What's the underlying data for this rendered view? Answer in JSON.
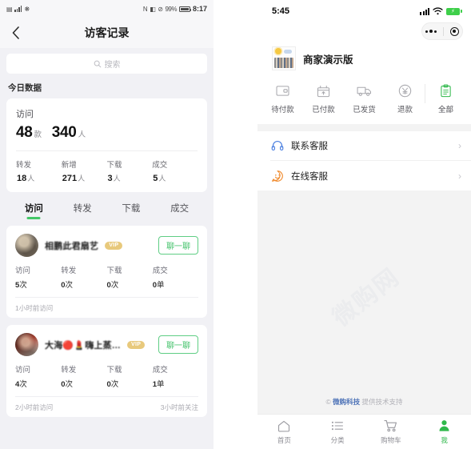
{
  "left_phone": {
    "status_bar": {
      "icons_left": [
        "sim-icon",
        "signal-icon",
        "wifi-icon"
      ],
      "icons_right": [
        "nfc-icon",
        "vibrate-icon",
        "dnd-icon"
      ],
      "battery_percent": "99%",
      "time": "8:17"
    },
    "navbar": {
      "back_icon": "back-chevron-icon",
      "title": "访客记录"
    },
    "search": {
      "icon": "search-icon",
      "placeholder": "搜索",
      "value": ""
    },
    "section_title": "今日数据",
    "data_card": {
      "label": "访问",
      "primary": [
        {
          "value": "48",
          "unit": "款"
        },
        {
          "value": "340",
          "unit": "人"
        }
      ],
      "metrics": [
        {
          "label": "转发",
          "value": "18",
          "unit": "人"
        },
        {
          "label": "新增",
          "value": "271",
          "unit": "人"
        },
        {
          "label": "下载",
          "value": "3",
          "unit": "人"
        },
        {
          "label": "成交",
          "value": "5",
          "unit": "人"
        }
      ]
    },
    "tabs": [
      {
        "label": "访问",
        "active": true
      },
      {
        "label": "转发",
        "active": false
      },
      {
        "label": "下载",
        "active": false
      },
      {
        "label": "成交",
        "active": false
      }
    ],
    "accent_green": "#44c767",
    "visitor_cards": [
      {
        "avatar": "avatar-blurred-1",
        "name": "相鹏此君扇艺",
        "vip_badge": "VIP",
        "chat_button": "聊一聊",
        "stats": [
          {
            "label": "访问",
            "value": "5",
            "unit": "次"
          },
          {
            "label": "转发",
            "value": "0",
            "unit": "次"
          },
          {
            "label": "下载",
            "value": "0",
            "unit": "次"
          },
          {
            "label": "成交",
            "value": "0",
            "unit": "单"
          }
        ],
        "footer_left": "1小时前访问",
        "footer_right": ""
      },
      {
        "avatar": "avatar-blurred-2",
        "name": "大海🔴💄嗨上蒸…",
        "vip_badge": "VIP",
        "chat_button": "聊一聊",
        "stats": [
          {
            "label": "访问",
            "value": "4",
            "unit": "次"
          },
          {
            "label": "转发",
            "value": "0",
            "unit": "次"
          },
          {
            "label": "下载",
            "value": "0",
            "unit": "次"
          },
          {
            "label": "成交",
            "value": "1",
            "unit": "单"
          }
        ],
        "footer_left": "2小时前访问",
        "footer_right": "3小时前关注"
      }
    ]
  },
  "right_phone": {
    "status_bar": {
      "time": "5:45",
      "icons": [
        "signal-icon",
        "wifi-icon",
        "battery-charging-icon"
      ]
    },
    "capsule": {
      "more_icon": "more-dots-icon",
      "close_icon": "target-circle-icon"
    },
    "shop": {
      "logo": "shop-photo-icon",
      "name": "商家演示版"
    },
    "order_actions": [
      {
        "icon": "wallet-icon",
        "label": "待付款",
        "highlight": false
      },
      {
        "icon": "box-icon",
        "label": "已付款",
        "highlight": false
      },
      {
        "icon": "truck-icon",
        "label": "已发货",
        "highlight": false
      },
      {
        "icon": "yuan-circle-icon",
        "label": "退款",
        "highlight": false
      },
      {
        "icon": "clipboard-icon",
        "label": "全部",
        "highlight": true
      }
    ],
    "service_rows": [
      {
        "icon": "headset-icon",
        "icon_color": "#4a7fe0",
        "label": "联系客服",
        "chevron": "›"
      },
      {
        "icon": "smiley-chat-icon",
        "icon_color": "#f08a2c",
        "label": "在线客服",
        "chevron": "›"
      }
    ],
    "watermark": "微购网",
    "footer": {
      "copyright": "©",
      "brand": "微购科技",
      "suffix": "提供技术支持"
    },
    "tabbar": [
      {
        "icon": "home-icon",
        "label": "首页",
        "active": false
      },
      {
        "icon": "category-icon",
        "label": "分类",
        "active": false
      },
      {
        "icon": "cart-icon",
        "label": "购物车",
        "active": false
      },
      {
        "icon": "person-icon",
        "label": "我",
        "active": true
      }
    ],
    "accent_green": "#2fb84a"
  }
}
